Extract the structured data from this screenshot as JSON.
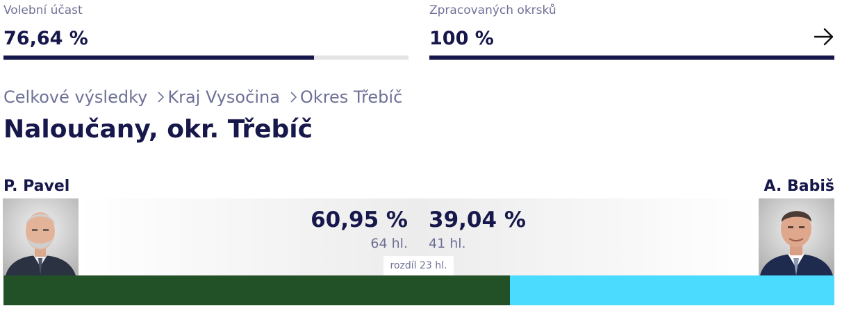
{
  "colors": {
    "navy": "#16174a",
    "muted": "#6e7196",
    "candidate1": "#235127",
    "candidate2": "#4adbff"
  },
  "turnout": {
    "label": "Volební účast",
    "value": "76,64 %",
    "fraction": 0.7664
  },
  "processed": {
    "label": "Zpracovaných okrsků",
    "value": "100 %",
    "fraction": 1.0,
    "arrow_icon": "arrow-right-icon"
  },
  "breadcrumb": [
    "Celkové výsledky",
    "Kraj Vysočina",
    "Okres Třebíč"
  ],
  "page_title": "Naloučany, okr. Třebíč",
  "candidates": [
    {
      "name": "P. Pavel",
      "percent": "60,95 %",
      "votes": "64 hl.",
      "share": 0.6095
    },
    {
      "name": "A. Babiš",
      "percent": "39,04 %",
      "votes": "41 hl.",
      "share": 0.3904
    }
  ],
  "difference": "rozdíl 23 hl."
}
